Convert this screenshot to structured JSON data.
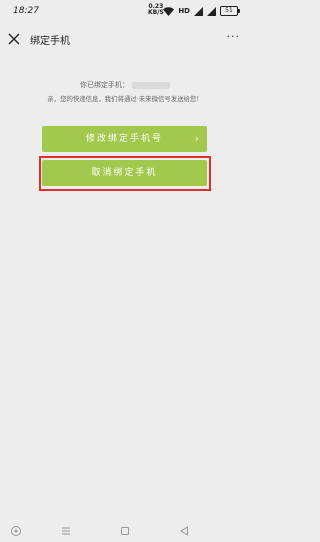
{
  "status_bar": {
    "time": "18:27",
    "speed_value": "0.23",
    "speed_unit": "KB/S",
    "hd_badge": "HD",
    "battery": "51"
  },
  "header": {
    "title": "绑定手机",
    "more_glyph": "···"
  },
  "info": {
    "line1_prefix": "你已绑定手机：",
    "line2": "亲，您的快递信息，我们将通过·未来微信号发送给您！"
  },
  "buttons": {
    "change_phone": "修改绑定手机号",
    "cancel_binding": "取消绑定手机"
  },
  "colors": {
    "button_green": "#a2c84d",
    "highlight_red": "#e0302a",
    "background": "#ededed"
  },
  "icons": {
    "close": "close-icon",
    "more": "more-icon",
    "chevron": "chevron-right-icon",
    "nav": [
      "circle-icon",
      "menu-icon",
      "square-icon",
      "back-icon"
    ]
  }
}
